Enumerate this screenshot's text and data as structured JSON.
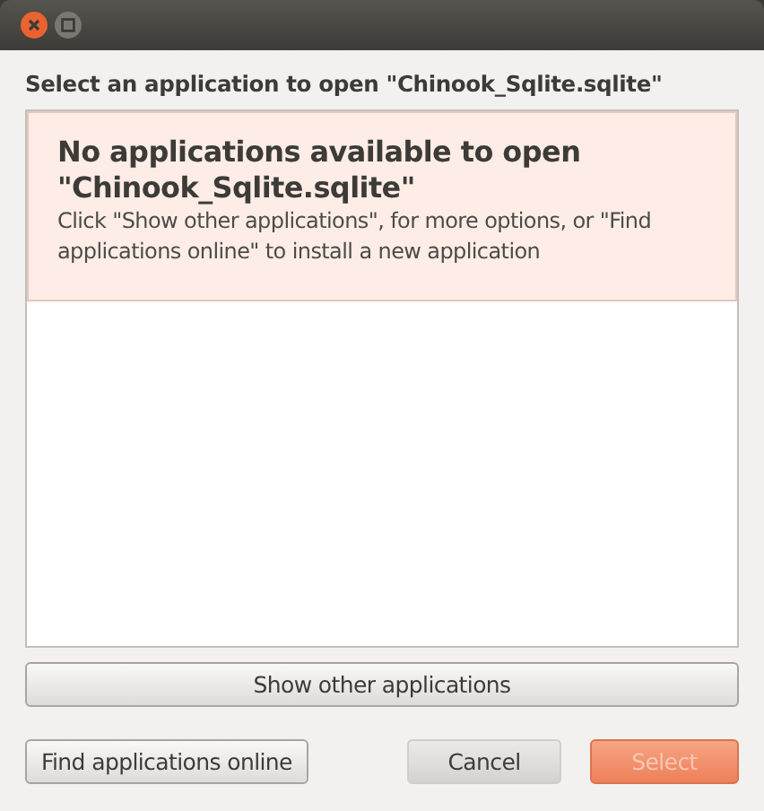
{
  "window": {
    "buttons": [
      {
        "kind": "close"
      },
      {
        "kind": "maximize"
      }
    ]
  },
  "heading": "Select an application to open \"Chinook_Sqlite.sqlite\"",
  "infobar": {
    "title": "No applications available to open \"Chinook_Sqlite.sqlite\"",
    "message": "Click \"Show other applications\", for more options, or \"Find applications online\" to install a new application"
  },
  "show_other_button": {
    "label": "Show other applications",
    "disabled": false
  },
  "buttons": [
    {
      "label": "Find applications online",
      "kind": "extra",
      "disabled": false
    },
    {
      "label": "Cancel",
      "kind": "cancel",
      "disabled": false
    },
    {
      "label": "Select",
      "kind": "default",
      "disabled": true
    }
  ]
}
